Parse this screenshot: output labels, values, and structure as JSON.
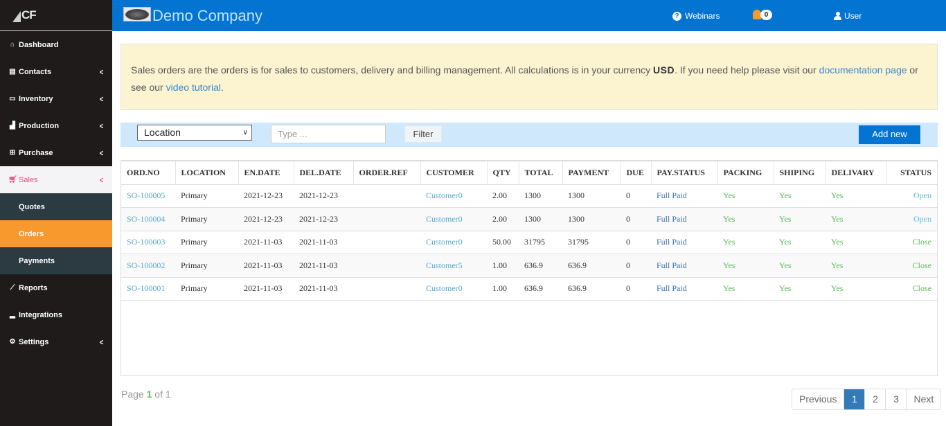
{
  "brand": {
    "logo_text": "CF"
  },
  "header": {
    "company_name": "Demo Company",
    "webinars_label": "Webinars",
    "notifications_count": "0",
    "user_label": "User"
  },
  "sidebar": {
    "items": [
      {
        "label": "Dashboard",
        "icon": "home-icon",
        "has_chevron": false
      },
      {
        "label": "Contacts",
        "icon": "address-book-icon",
        "has_chevron": true
      },
      {
        "label": "Inventory",
        "icon": "folder-open-icon",
        "has_chevron": true
      },
      {
        "label": "Production",
        "icon": "industry-icon",
        "has_chevron": true
      },
      {
        "label": "Purchase",
        "icon": "basket-icon",
        "has_chevron": true
      },
      {
        "label": "Sales",
        "icon": "cart-icon",
        "has_chevron": true,
        "active": true
      },
      {
        "label": "Reports",
        "icon": "line-chart-icon",
        "has_chevron": false
      },
      {
        "label": "Integrations",
        "icon": "signal-icon",
        "has_chevron": false
      },
      {
        "label": "Settings",
        "icon": "gear-icon",
        "has_chevron": true
      }
    ],
    "sales_submenu": [
      {
        "label": "Quotes"
      },
      {
        "label": "Orders",
        "current": true
      },
      {
        "label": "Payments"
      }
    ]
  },
  "info": {
    "text_1": "Sales orders are the orders is for sales to customers, delivery and billing management. All calculations is in your currency ",
    "currency": "USD",
    "text_2": ". If you need help please visit our ",
    "doc_link": "documentation page",
    "text_3": " or see our ",
    "video_link": "video tutorial",
    "text_4": "."
  },
  "filter": {
    "location_selected": "Location",
    "search_placeholder": "Type ...",
    "filter_label": "Filter",
    "add_new_label": "Add new"
  },
  "table": {
    "columns": [
      "ORD.NO",
      "LOCATION",
      "EN.DATE",
      "DEL.DATE",
      "ORDER.REF",
      "CUSTOMER",
      "QTY",
      "TOTAL",
      "PAYMENT",
      "DUE",
      "PAY.STATUS",
      "PACKING",
      "SHIPING",
      "DELIVARY",
      "STATUS"
    ],
    "rows": [
      {
        "ord_no": "SO-100005",
        "location": "Primary",
        "en_date": "2021-12-23",
        "del_date": "2021-12-23",
        "order_ref": "",
        "customer": "Customer0",
        "qty": "2.00",
        "total": "1300",
        "payment": "1300",
        "due": "0",
        "pay_status": "Full Paid",
        "packing": "Yes",
        "shiping": "Yes",
        "delivary": "Yes",
        "status": "Open"
      },
      {
        "ord_no": "SO-100004",
        "location": "Primary",
        "en_date": "2021-12-23",
        "del_date": "2021-12-23",
        "order_ref": "",
        "customer": "Customer0",
        "qty": "2.00",
        "total": "1300",
        "payment": "1300",
        "due": "0",
        "pay_status": "Full Paid",
        "packing": "Yes",
        "shiping": "Yes",
        "delivary": "Yes",
        "status": "Open"
      },
      {
        "ord_no": "SO-100003",
        "location": "Primary",
        "en_date": "2021-11-03",
        "del_date": "2021-11-03",
        "order_ref": "",
        "customer": "Customer0",
        "qty": "50.00",
        "total": "31795",
        "payment": "31795",
        "due": "0",
        "pay_status": "Full Paid",
        "packing": "Yes",
        "shiping": "Yes",
        "delivary": "Yes",
        "status": "Close"
      },
      {
        "ord_no": "SO-100002",
        "location": "Primary",
        "en_date": "2021-11-03",
        "del_date": "2021-11-03",
        "order_ref": "",
        "customer": "Customer5",
        "qty": "1.00",
        "total": "636.9",
        "payment": "636.9",
        "due": "0",
        "pay_status": "Full Paid",
        "packing": "Yes",
        "shiping": "Yes",
        "delivary": "Yes",
        "status": "Close"
      },
      {
        "ord_no": "SO-100001",
        "location": "Primary",
        "en_date": "2021-11-03",
        "del_date": "2021-11-03",
        "order_ref": "",
        "customer": "Customer0",
        "qty": "1.00",
        "total": "636.9",
        "payment": "636.9",
        "due": "0",
        "pay_status": "Full Paid",
        "packing": "Yes",
        "shiping": "Yes",
        "delivary": "Yes",
        "status": "Close"
      }
    ]
  },
  "pagination": {
    "page_label": "Page",
    "current_page": "1",
    "of_label": "of",
    "total_pages": "1",
    "previous_label": "Previous",
    "next_label": "Next",
    "pages": [
      "1",
      "2",
      "3"
    ],
    "active_page": "1"
  }
}
